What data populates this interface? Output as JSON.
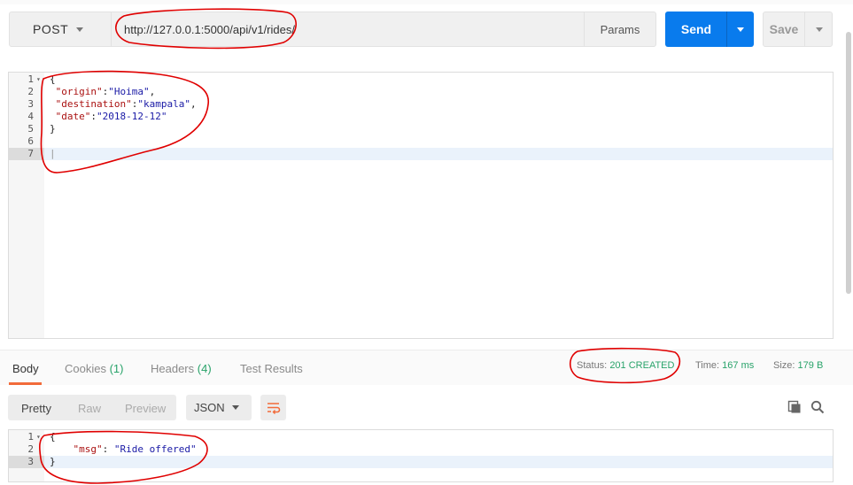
{
  "request": {
    "method": "POST",
    "url": "http://127.0.0.1:5000/api/v1/rides/",
    "params_label": "Params",
    "send_label": "Send",
    "save_label": "Save"
  },
  "request_body": {
    "line_numbers": [
      "1",
      "2",
      "3",
      "4",
      "5",
      "6",
      "7"
    ],
    "open_brace": "{",
    "close_brace": "}",
    "fields": [
      {
        "key": "\"origin\"",
        "value": "\"Hoima\"",
        "sep": ",",
        "colon": ":"
      },
      {
        "key": "\"destination\"",
        "value": "\"kampala\"",
        "sep": ",",
        "colon": ":"
      },
      {
        "key": "\"date\"",
        "value": "\"2018-12-12\"",
        "sep": "",
        "colon": ":"
      }
    ]
  },
  "response_tabs": {
    "body": "Body",
    "cookies": "Cookies",
    "cookies_count": "(1)",
    "headers": "Headers",
    "headers_count": "(4)",
    "tests": "Test Results"
  },
  "response_meta": {
    "status_label": "Status:",
    "status_value": "201 CREATED",
    "time_label": "Time:",
    "time_value": "167 ms",
    "size_label": "Size:",
    "size_value": "179 B"
  },
  "response_view": {
    "pretty": "Pretty",
    "raw": "Raw",
    "preview": "Preview",
    "format": "JSON"
  },
  "response_body": {
    "line_numbers": [
      "1",
      "2",
      "3"
    ],
    "open_brace": "{",
    "close_brace": "}",
    "key": "\"msg\"",
    "colon": ": ",
    "value": "\"Ride offered\""
  },
  "colors": {
    "accent": "#097bed",
    "status_ok": "#29a36a",
    "tab_indicator": "#f26b3a",
    "annotation": "#e00000"
  },
  "icons": [
    "chevron-down-icon",
    "wrap-lines-icon",
    "copy-icon",
    "search-icon",
    "fold-arrow-icon"
  ]
}
